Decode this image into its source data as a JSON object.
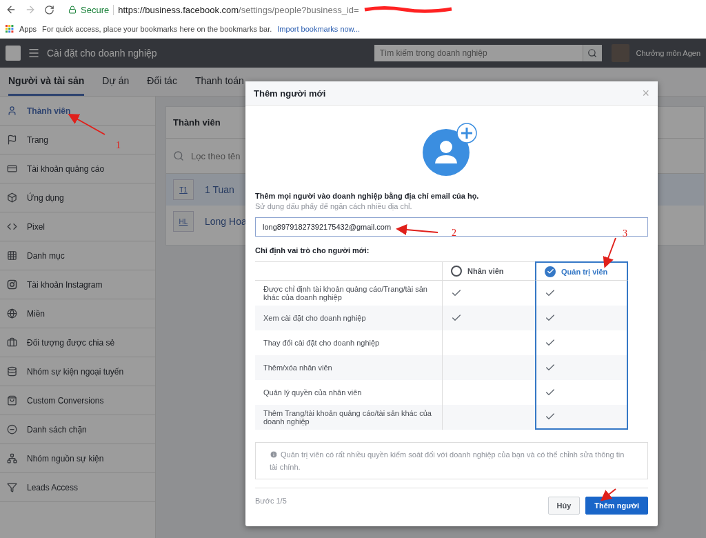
{
  "browser": {
    "secure_label": "Secure",
    "url_host": "https://business.facebook.com",
    "url_path": "/settings/people?business_id=",
    "bookmarks": {
      "apps": "Apps",
      "hint": "For quick access, place your bookmarks here on the bookmarks bar.",
      "import_link": "Import bookmarks now..."
    }
  },
  "topbar": {
    "title": "Cài đặt cho doanh nghiệp",
    "search_placeholder": "Tìm kiếm trong doanh nghiệp",
    "account_name": "Chưởng môn Agen"
  },
  "tabs": [
    {
      "label": "Người và tài sản",
      "selected": true
    },
    {
      "label": "Dự án",
      "selected": false
    },
    {
      "label": "Đối tác",
      "selected": false
    },
    {
      "label": "Thanh toán",
      "selected": false
    }
  ],
  "sidebar": [
    {
      "kind": "person",
      "label": "Thành viên",
      "selected": true
    },
    {
      "kind": "flag",
      "label": "Trang",
      "selected": false
    },
    {
      "kind": "ad",
      "label": "Tài khoản quảng cáo",
      "selected": false
    },
    {
      "kind": "cube",
      "label": "Ứng dụng",
      "selected": false
    },
    {
      "kind": "code",
      "label": "Pixel",
      "selected": false
    },
    {
      "kind": "grid",
      "label": "Danh mục",
      "selected": false
    },
    {
      "kind": "camera",
      "label": "Tài khoản Instagram",
      "selected": false
    },
    {
      "kind": "globe",
      "label": "Miền",
      "selected": false
    },
    {
      "kind": "briefcase",
      "label": "Đối tượng được chia sẻ",
      "selected": false
    },
    {
      "kind": "stack",
      "label": "Nhóm sự kiện ngoại tuyến",
      "selected": false
    },
    {
      "kind": "bag",
      "label": "Custom Conversions",
      "selected": false
    },
    {
      "kind": "block",
      "label": "Danh sách chặn",
      "selected": false
    },
    {
      "kind": "network",
      "label": "Nhóm nguồn sự kiện",
      "selected": false
    },
    {
      "kind": "funnel",
      "label": "Leads Access",
      "selected": false
    }
  ],
  "panel": {
    "title": "Thành viên",
    "filter_placeholder": "Lọc theo tên",
    "members": [
      {
        "initials": "T1",
        "name": "1 Tuan",
        "selected": true
      },
      {
        "initials": "HL",
        "name": "Long Hoa",
        "selected": false
      }
    ]
  },
  "modal": {
    "title": "Thêm người mới",
    "close": "×",
    "intro": "Thêm mọi người vào doanh nghiệp bằng địa chỉ email của họ.",
    "hint": "Sử dụng dấu phẩy để ngăn cách nhiều địa chỉ.",
    "email": "long89791827392175432@gmail.com",
    "role_label": "Chỉ định vai trò cho người mới:",
    "roles": [
      {
        "label": "Nhân viên",
        "selected": false
      },
      {
        "label": "Quản trị viên",
        "selected": true
      }
    ],
    "permissions": [
      {
        "label": "Được chỉ định tài khoản quảng cáo/Trang/tài sản khác của doanh nghiệp",
        "staff": true,
        "admin": true
      },
      {
        "label": "Xem cài đặt cho doanh nghiệp",
        "staff": true,
        "admin": true
      },
      {
        "label": "Thay đổi cài đặt cho doanh nghiệp",
        "staff": false,
        "admin": true
      },
      {
        "label": "Thêm/xóa nhân viên",
        "staff": false,
        "admin": true
      },
      {
        "label": "Quản lý quyền của nhân viên",
        "staff": false,
        "admin": true
      },
      {
        "label": "Thêm Trang/tài khoản quảng cáo/tài sản khác của doanh nghiệp",
        "staff": false,
        "admin": true
      }
    ],
    "info": "Quản trị viên có rất nhiều quyền kiểm soát đối với doanh nghiệp của bạn và có thể chỉnh sửa thông tin tài chính.",
    "step": "Bước 1/5",
    "cancel": "Hủy",
    "submit": "Thêm người"
  },
  "annotations": [
    {
      "label": "1"
    },
    {
      "label": "2"
    },
    {
      "label": "3"
    }
  ]
}
